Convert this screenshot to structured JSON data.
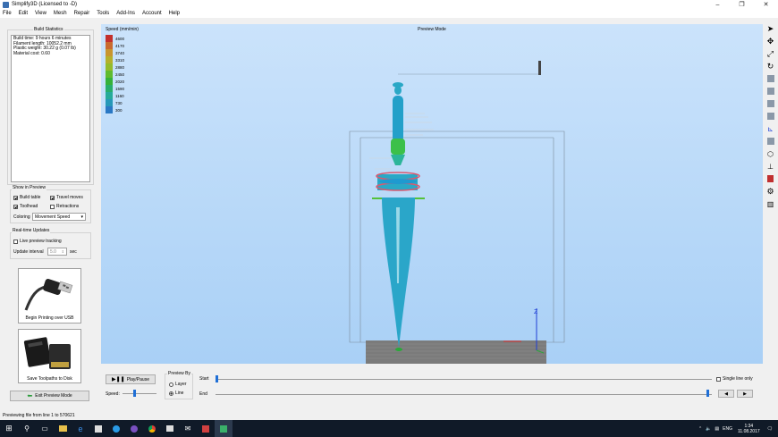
{
  "window": {
    "title": "Simplify3D (Licensed to -D)",
    "minimize": "–",
    "maximize": "❐",
    "close": "✕"
  },
  "menu": [
    "File",
    "Edit",
    "View",
    "Mesh",
    "Repair",
    "Tools",
    "Add-Ins",
    "Account",
    "Help"
  ],
  "build_stats": {
    "title": "Build Statistics",
    "lines": [
      "Build time: 9 hours 6 minutes",
      "Filament length: 10052.2 mm",
      "Plastic weight: 30.22 g (0.07 lb)",
      "Material cost: 0.60"
    ]
  },
  "show_in_preview": {
    "title": "Show in Preview",
    "build_table": "Build table",
    "travel_moves": "Travel moves",
    "toolhead": "Toolhead",
    "retractions": "Retractions",
    "coloring_label": "Coloring",
    "coloring_value": "Movement Speed"
  },
  "realtime": {
    "title": "Real-time Updates",
    "live_tracking": "Live preview tracking",
    "interval_label": "Update interval",
    "interval_value": "5.0",
    "interval_unit": "sec"
  },
  "usb_card": {
    "label": "Begin Printing over USB"
  },
  "sd_card": {
    "label": "Save Toolpaths to Disk"
  },
  "exit_button": "Exit Preview Mode",
  "viewport": {
    "mode": "Preview Mode",
    "legend_title": "Speed (mm/min)",
    "legend": [
      {
        "label": "4600",
        "color": "#c3302c"
      },
      {
        "label": "4170",
        "color": "#c96a2e"
      },
      {
        "label": "3740",
        "color": "#c8952f"
      },
      {
        "label": "3310",
        "color": "#b4b02c"
      },
      {
        "label": "2880",
        "color": "#94bb2c"
      },
      {
        "label": "2450",
        "color": "#5fbb2f"
      },
      {
        "label": "2020",
        "color": "#35b23a"
      },
      {
        "label": "1590",
        "color": "#27ae6c"
      },
      {
        "label": "1160",
        "color": "#25ab9a"
      },
      {
        "label": "730",
        "color": "#2698b8"
      },
      {
        "label": "300",
        "color": "#2a78c4"
      }
    ]
  },
  "playback": {
    "play_pause": "Play/Pause",
    "speed_label": "Speed:",
    "preview_by": "Preview By",
    "layer": "Layer",
    "line": "Line",
    "start": "Start",
    "end": "End",
    "single_line": "Single line only"
  },
  "status": "Previewing file from line 1 to 570621",
  "tray": {
    "lang": "ENG",
    "time": "1:34",
    "date": "11.08.2017"
  }
}
